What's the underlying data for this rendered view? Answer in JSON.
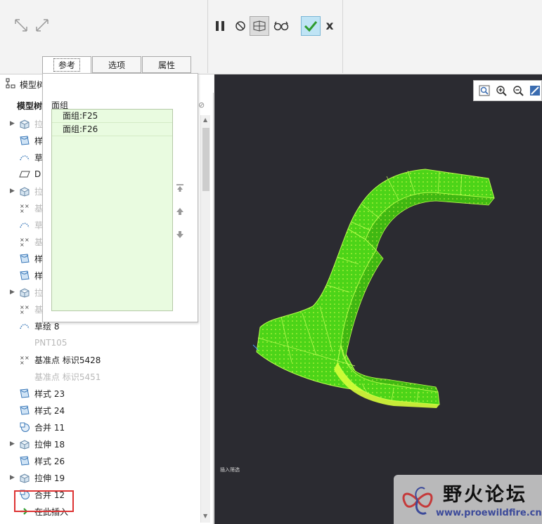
{
  "tabs": [
    {
      "label": "参考",
      "active": true
    },
    {
      "label": "选项",
      "active": false
    },
    {
      "label": "属性",
      "active": false
    }
  ],
  "toolbar": {
    "icons": [
      "pause-icon",
      "no-preview-icon",
      "verify-mode-icon",
      "glasses-icon",
      "confirm-check-icon",
      "cancel-x-icon"
    ],
    "cancel_glyph": "x"
  },
  "model_tree": {
    "panel_title": "模型树",
    "header_label": "模型树",
    "items": [
      {
        "label": "拉",
        "icon": "extrude-icon",
        "expandable": true,
        "dim": true
      },
      {
        "label": "样",
        "icon": "style-icon",
        "expandable": false,
        "dim": false
      },
      {
        "label": "草",
        "icon": "sketch-icon",
        "expandable": false,
        "dim": false
      },
      {
        "label": "D",
        "icon": "datum-plane-icon",
        "expandable": false,
        "dim": false
      },
      {
        "label": "拉",
        "icon": "extrude-icon",
        "expandable": true,
        "dim": true
      },
      {
        "label": "基",
        "icon": "datum-point-icon",
        "expandable": false,
        "dim": true
      },
      {
        "label": "草",
        "icon": "sketch-icon",
        "expandable": false,
        "dim": true
      },
      {
        "label": "基",
        "icon": "datum-point-icon",
        "expandable": false,
        "dim": true
      },
      {
        "label": "样",
        "icon": "style-icon",
        "expandable": false,
        "dim": false
      },
      {
        "label": "样",
        "icon": "style-icon",
        "expandable": false,
        "dim": false
      },
      {
        "label": "拉",
        "icon": "extrude-icon",
        "expandable": true,
        "dim": true
      },
      {
        "label": "基",
        "icon": "datum-point-icon",
        "expandable": false,
        "dim": true
      },
      {
        "label": "草绘 8",
        "icon": "sketch-icon",
        "expandable": false,
        "dim": false
      },
      {
        "label": "PNT105",
        "icon": "none",
        "expandable": false,
        "dim": true
      },
      {
        "label": "基准点 标识5428",
        "icon": "datum-point-icon",
        "expandable": false,
        "dim": false
      },
      {
        "label": "基准点 标识5451",
        "icon": "none",
        "expandable": false,
        "dim": true
      },
      {
        "label": "样式 23",
        "icon": "style-icon",
        "expandable": false,
        "dim": false
      },
      {
        "label": "样式 24",
        "icon": "style-icon",
        "expandable": false,
        "dim": false
      },
      {
        "label": "合并 11",
        "icon": "merge-icon",
        "expandable": false,
        "dim": false
      },
      {
        "label": "拉伸 18",
        "icon": "extrude-icon",
        "expandable": true,
        "dim": false
      },
      {
        "label": "样式 26",
        "icon": "style-icon",
        "expandable": false,
        "dim": false
      },
      {
        "label": "拉伸 19",
        "icon": "extrude-icon",
        "expandable": true,
        "dim": false
      },
      {
        "label": "合并 12",
        "icon": "merge-icon",
        "expandable": false,
        "dim": false
      },
      {
        "label": "在此插入",
        "icon": "insert-arrow-icon",
        "expandable": false,
        "dim": false
      }
    ]
  },
  "references_panel": {
    "collector_label": "面组",
    "items": [
      "面组:F25",
      "面组:F26"
    ]
  },
  "viewport": {
    "status_text": "插入筛选",
    "background": "#2b2b31",
    "model_color": "#4cd418"
  },
  "watermark": {
    "title": "野火论坛",
    "url": "www.proewildfire.cn"
  },
  "colors": {
    "highlight": "#d33333",
    "collector_bg": "#e9fbe0",
    "confirm": "#2e9c2e"
  }
}
